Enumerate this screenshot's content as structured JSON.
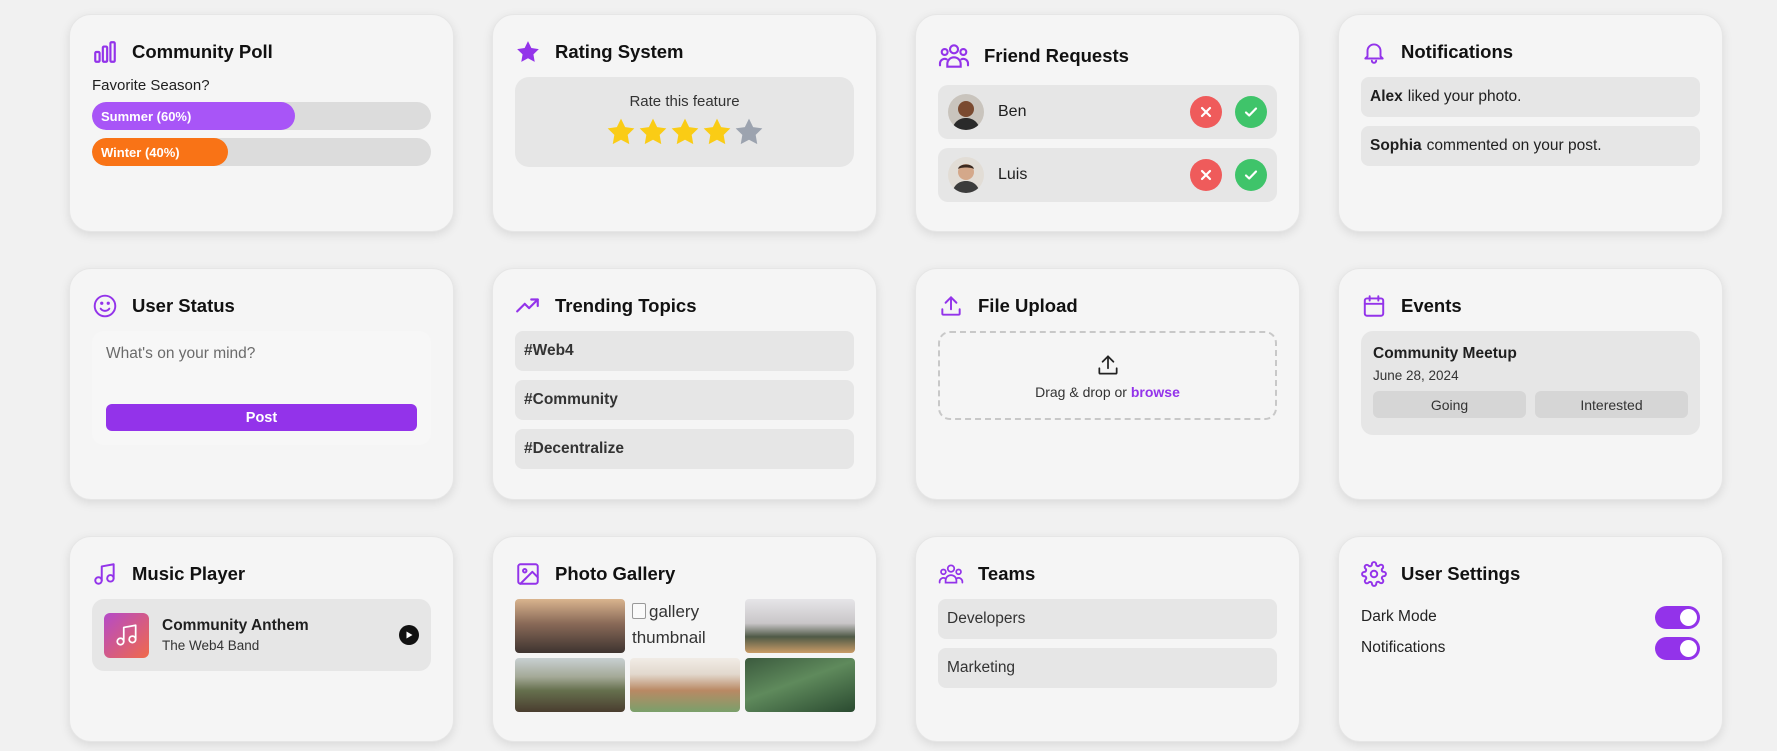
{
  "colors": {
    "accent": "#9333ea",
    "poll_summer": "#a855f7",
    "poll_winter": "#f97316",
    "reject": "#ef5b5b",
    "accept": "#3fc46a",
    "star_filled": "#facc15",
    "star_empty": "#9ca3af"
  },
  "poll": {
    "title": "Community Poll",
    "question": "Favorite Season?",
    "options": [
      {
        "label": "Summer (60%)",
        "percent": 60
      },
      {
        "label": "Winter (40%)",
        "percent": 40
      }
    ]
  },
  "rating": {
    "title": "Rating System",
    "label": "Rate this feature",
    "value": 4,
    "max": 5
  },
  "friends": {
    "title": "Friend Requests",
    "requests": [
      {
        "name": "Ben"
      },
      {
        "name": "Luis"
      }
    ]
  },
  "notifications": {
    "title": "Notifications",
    "items": [
      {
        "user": "Alex",
        "text": "liked your photo."
      },
      {
        "user": "Sophia",
        "text": "commented on your post."
      }
    ]
  },
  "status": {
    "title": "User Status",
    "placeholder": "What's on your mind?",
    "post_label": "Post"
  },
  "trending": {
    "title": "Trending Topics",
    "topics": [
      "#Web4",
      "#Community",
      "#Decentralize"
    ]
  },
  "upload": {
    "title": "File Upload",
    "text": "Drag & drop or",
    "browse": "browse"
  },
  "events": {
    "title": "Events",
    "event_title": "Community Meetup",
    "date": "June 28, 2024",
    "going_label": "Going",
    "interested_label": "Interested"
  },
  "music": {
    "title": "Music Player",
    "track": "Community Anthem",
    "artist": "The Web4 Band"
  },
  "gallery": {
    "title": "Photo Gallery",
    "broken_alt": "gallery thumbnail"
  },
  "teams": {
    "title": "Teams",
    "items": [
      "Developers",
      "Marketing"
    ]
  },
  "settings": {
    "title": "User Settings",
    "items": [
      {
        "label": "Dark Mode",
        "on": true
      },
      {
        "label": "Notifications",
        "on": true
      }
    ]
  }
}
